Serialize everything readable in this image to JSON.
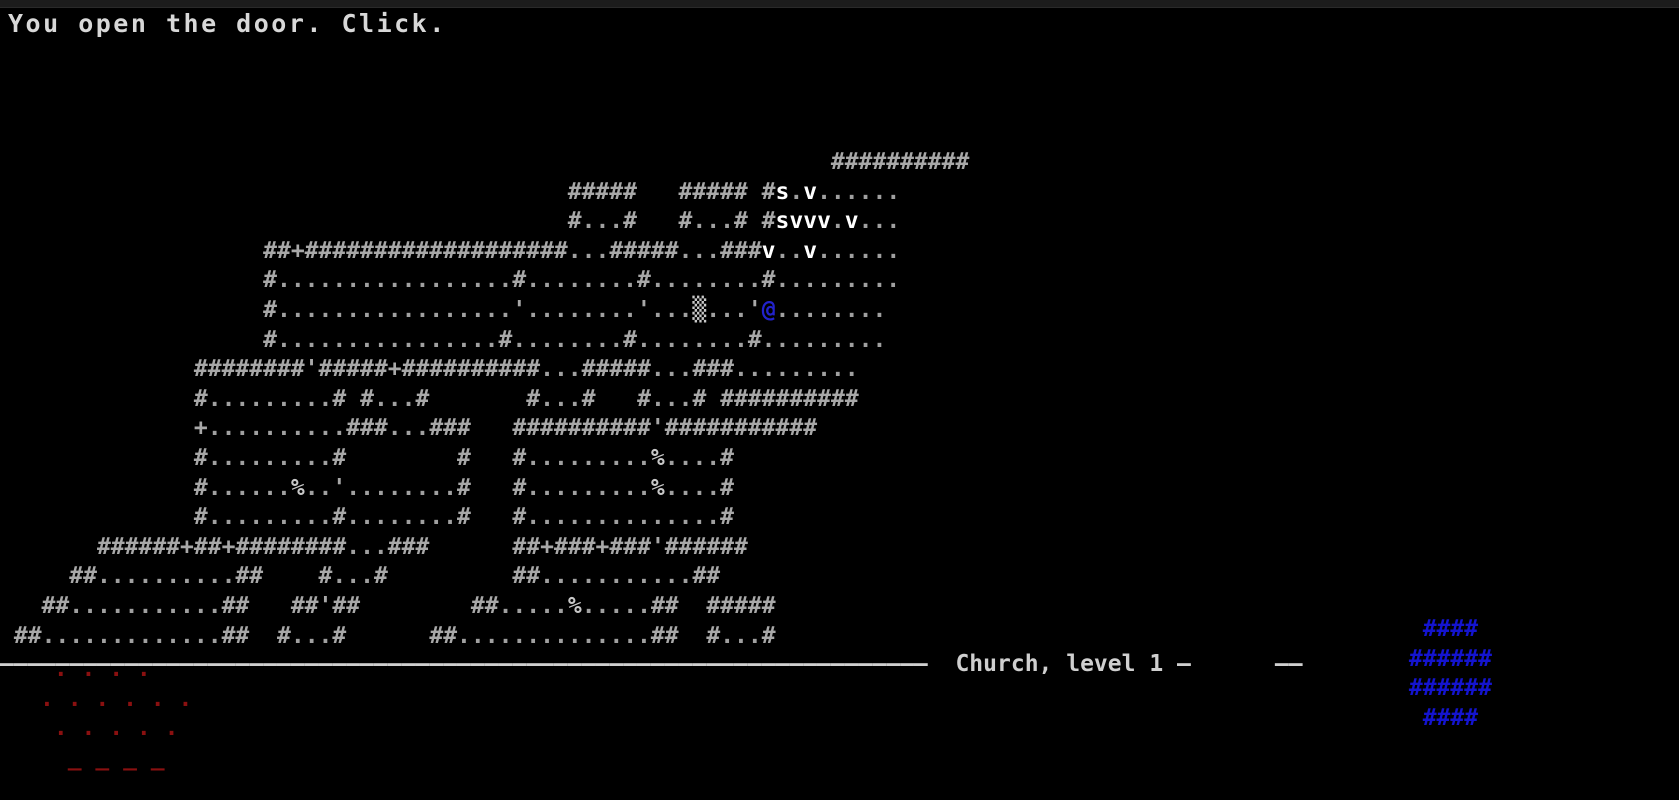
{
  "app": {
    "kind": "roguelike-terminal",
    "background_color": "#000000",
    "foreground_color": "#a8a8a8"
  },
  "message": {
    "text": "You open the door. Click."
  },
  "status": {
    "location_text": "Church, level 1",
    "left_rule": "———————————————————————————————————————————————————————————————————",
    "right_rule_short": "—",
    "right_rule_tail": "——"
  },
  "legend": {
    "wall": "#",
    "floor": ".",
    "closed_door": "+",
    "open_door": "'",
    "item_food": "%",
    "player": "@",
    "monster_s": "s",
    "monster_v": "v",
    "rubble": "▒"
  },
  "colors": {
    "wall": "#a8a8a8",
    "floor": "#a0a0a0",
    "monster": "#ffffff",
    "player": "#2222cc",
    "overlay_red": "#8a1010",
    "overlay_blue": "#1414cf",
    "message": "#d8d8d8",
    "status": "#cfcfcf"
  },
  "map": {
    "rows": [
      "                                                            ##########",
      "                                         #####   ##### #s.v......",
      "                                         #...#   #...# #svvv.v...",
      "                   ##+###################...#####...###v..v......",
      "                   #.................#........#........#.........",
      "                   #.................'........'...▒...'@........",
      "                   #................#........#........#.........",
      "              ########'#####+##########...#####...###.........",
      "              #.........# #...#       #...#   #...# ##########",
      "              +..........###...###   ##########'###########",
      "              #.........#        #   #.........%....#",
      "              #......%..'........#   #.........%....#",
      "              #.........#........#   #..............#",
      "       ######+##+########...###      ##+###+###'######",
      "     ##..........##    #...#         ##...........##",
      "   ##...........##   ##'##        ##.....%.....##  #####",
      " ##.............##  #...#      ##..............##  #...#"
    ]
  },
  "overlay_left": {
    "glyph": ".",
    "rows": [
      " . . . . ",
      ". . . . . .",
      " . . . . .",
      "  _ _ _ _"
    ]
  },
  "overlay_right": {
    "glyph": "#",
    "rows": [
      "  ####",
      " ######",
      " ######",
      "  ####"
    ]
  }
}
